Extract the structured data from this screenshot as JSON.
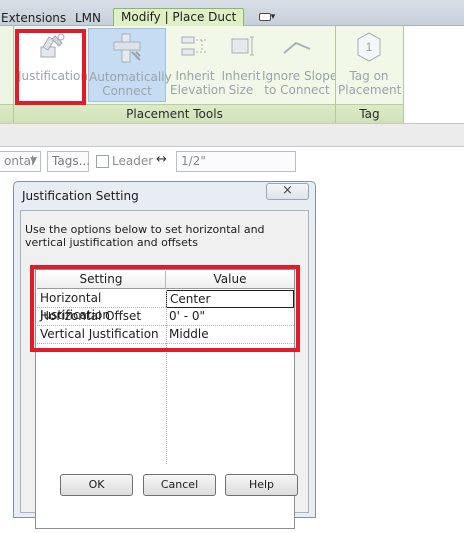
{
  "ribbon": {
    "tabs": [
      "Extensions",
      "LMN",
      "Modify | Place Duct"
    ],
    "panels": {
      "placement_tools": {
        "title": "Placement Tools",
        "tools": [
          {
            "label": "Justification",
            "icon": "justification-icon"
          },
          {
            "label": "Automatically\nConnect",
            "icon": "auto-connect-icon"
          },
          {
            "label": "Inherit\nElevation",
            "icon": "inherit-elevation-icon"
          },
          {
            "label": "Inherit\nSize",
            "icon": "inherit-size-icon"
          },
          {
            "label": "Ignore Slope\nto Connect",
            "icon": "ignore-slope-icon"
          }
        ]
      },
      "tag": {
        "title": "Tag",
        "tools": [
          {
            "label": "Tag on\nPlacement",
            "icon": "tag-icon",
            "icon_text": "1"
          }
        ]
      }
    }
  },
  "options_bar": {
    "placement_dropdown": "ontal",
    "tags_button": "Tags...",
    "leader_label": "Leader",
    "leader_length": "1/2\""
  },
  "dialog": {
    "title": "Justification Setting",
    "close_glyph": "×",
    "description": "Use the options below to set horizontal and vertical justification and offsets",
    "table": {
      "headers": [
        "Setting",
        "Value"
      ],
      "rows": [
        {
          "setting": "Horizontal Justification",
          "value": "Center"
        },
        {
          "setting": "Horizontal Offset",
          "value": "0' - 0\""
        },
        {
          "setting": "Vertical Justification",
          "value": "Middle"
        }
      ]
    },
    "buttons": {
      "ok": "OK",
      "cancel": "Cancel",
      "help": "Help"
    }
  },
  "colors": {
    "highlight": "#e21a2a",
    "ribbon_panel": "#f1f8e8",
    "active_tab": "#dff0c6"
  }
}
